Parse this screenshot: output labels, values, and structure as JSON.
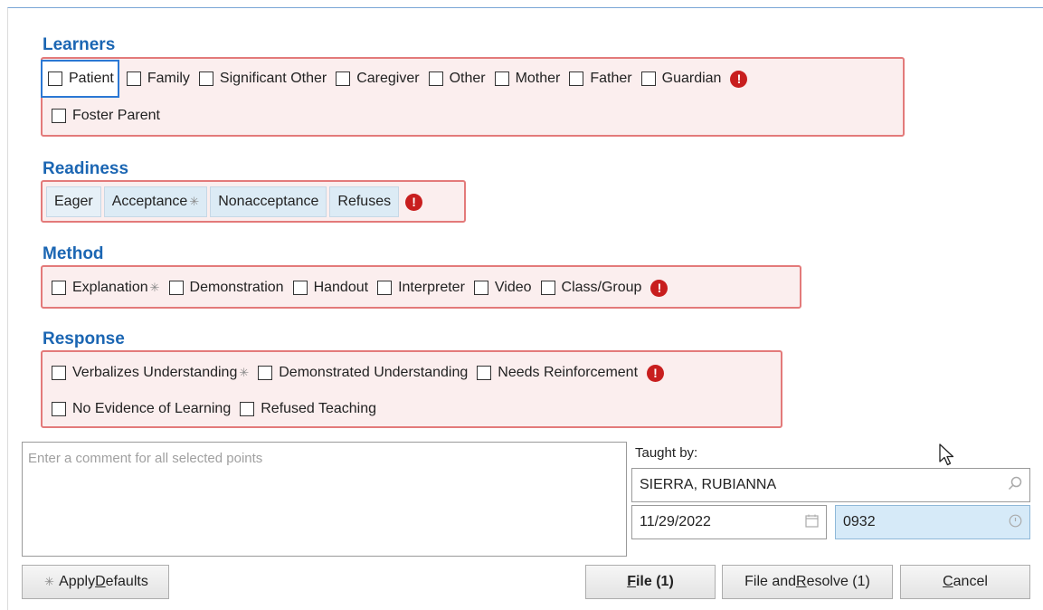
{
  "learners": {
    "title": "Learners",
    "items": [
      "Patient",
      "Family",
      "Significant Other",
      "Caregiver",
      "Other",
      "Mother",
      "Father",
      "Guardian",
      "Foster Parent"
    ]
  },
  "readiness": {
    "title": "Readiness",
    "options": [
      "Eager",
      "Acceptance",
      "Nonacceptance",
      "Refuses"
    ]
  },
  "method": {
    "title": "Method",
    "items": [
      "Explanation",
      "Demonstration",
      "Handout",
      "Interpreter",
      "Video",
      "Class/Group"
    ]
  },
  "response": {
    "title": "Response",
    "items": [
      "Verbalizes Understanding",
      "Demonstrated Understanding",
      "Needs Reinforcement",
      "No Evidence of Learning",
      "Refused Teaching"
    ]
  },
  "comment": {
    "placeholder": "Enter a comment for all selected points"
  },
  "taught_by": {
    "label": "Taught by:",
    "name": "SIERRA, RUBIANNA",
    "date": "11/29/2022",
    "time": "0932"
  },
  "buttons": {
    "apply_defaults": {
      "pre": "Apply ",
      "accel": "D",
      "post": "efaults"
    },
    "file": {
      "accel": "F",
      "post": "ile (1)"
    },
    "file_resolve": {
      "pre": "File and ",
      "accel": "R",
      "post": "esolve (1)"
    },
    "cancel": {
      "accel": "C",
      "post": "ancel"
    }
  },
  "symbols": {
    "required": "!",
    "default": "✳"
  },
  "icons": {
    "required": "exclamation-circle-icon",
    "default_marker": "asterisk-icon",
    "search": "search-icon",
    "calendar": "calendar-icon",
    "clock": "clock-icon",
    "cursor": "mouse-pointer-icon"
  },
  "colors": {
    "section_title": "#1b66b3",
    "group_border": "#e37a7a",
    "group_bg": "#fbeeee",
    "required_icon": "#c81e1e",
    "focus": "#2b78d4"
  }
}
